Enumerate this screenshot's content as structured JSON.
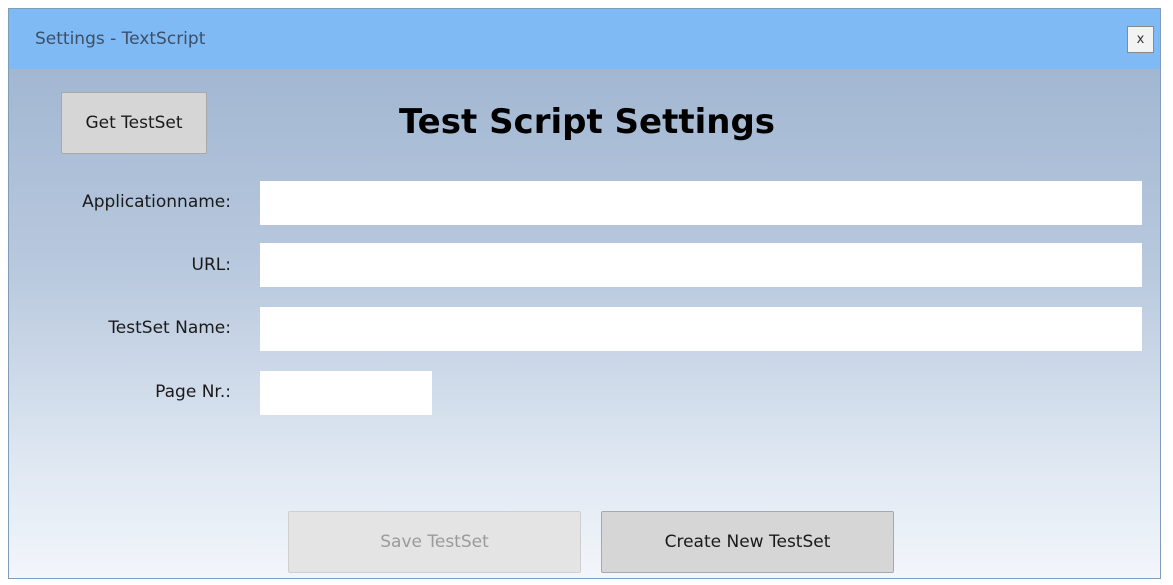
{
  "window": {
    "title": "Settings - TextScript",
    "close_label": "x"
  },
  "toolbar": {
    "get_testset_label": "Get TestSet"
  },
  "heading": "Test Script Settings",
  "form": {
    "applicationname": {
      "label": "Applicationname:",
      "value": ""
    },
    "url": {
      "label": "URL:",
      "value": ""
    },
    "testset_name": {
      "label": "TestSet Name:",
      "value": ""
    },
    "page_nr": {
      "label": "Page Nr.:",
      "value": ""
    }
  },
  "footer": {
    "save_label": "Save TestSet",
    "save_enabled": false,
    "create_label": "Create New TestSet"
  },
  "colors": {
    "titlebar": "#7fbaf5",
    "background_top": "#a2b7d2",
    "background_bottom": "#f3f6fb",
    "button": "#d6d6d6"
  }
}
